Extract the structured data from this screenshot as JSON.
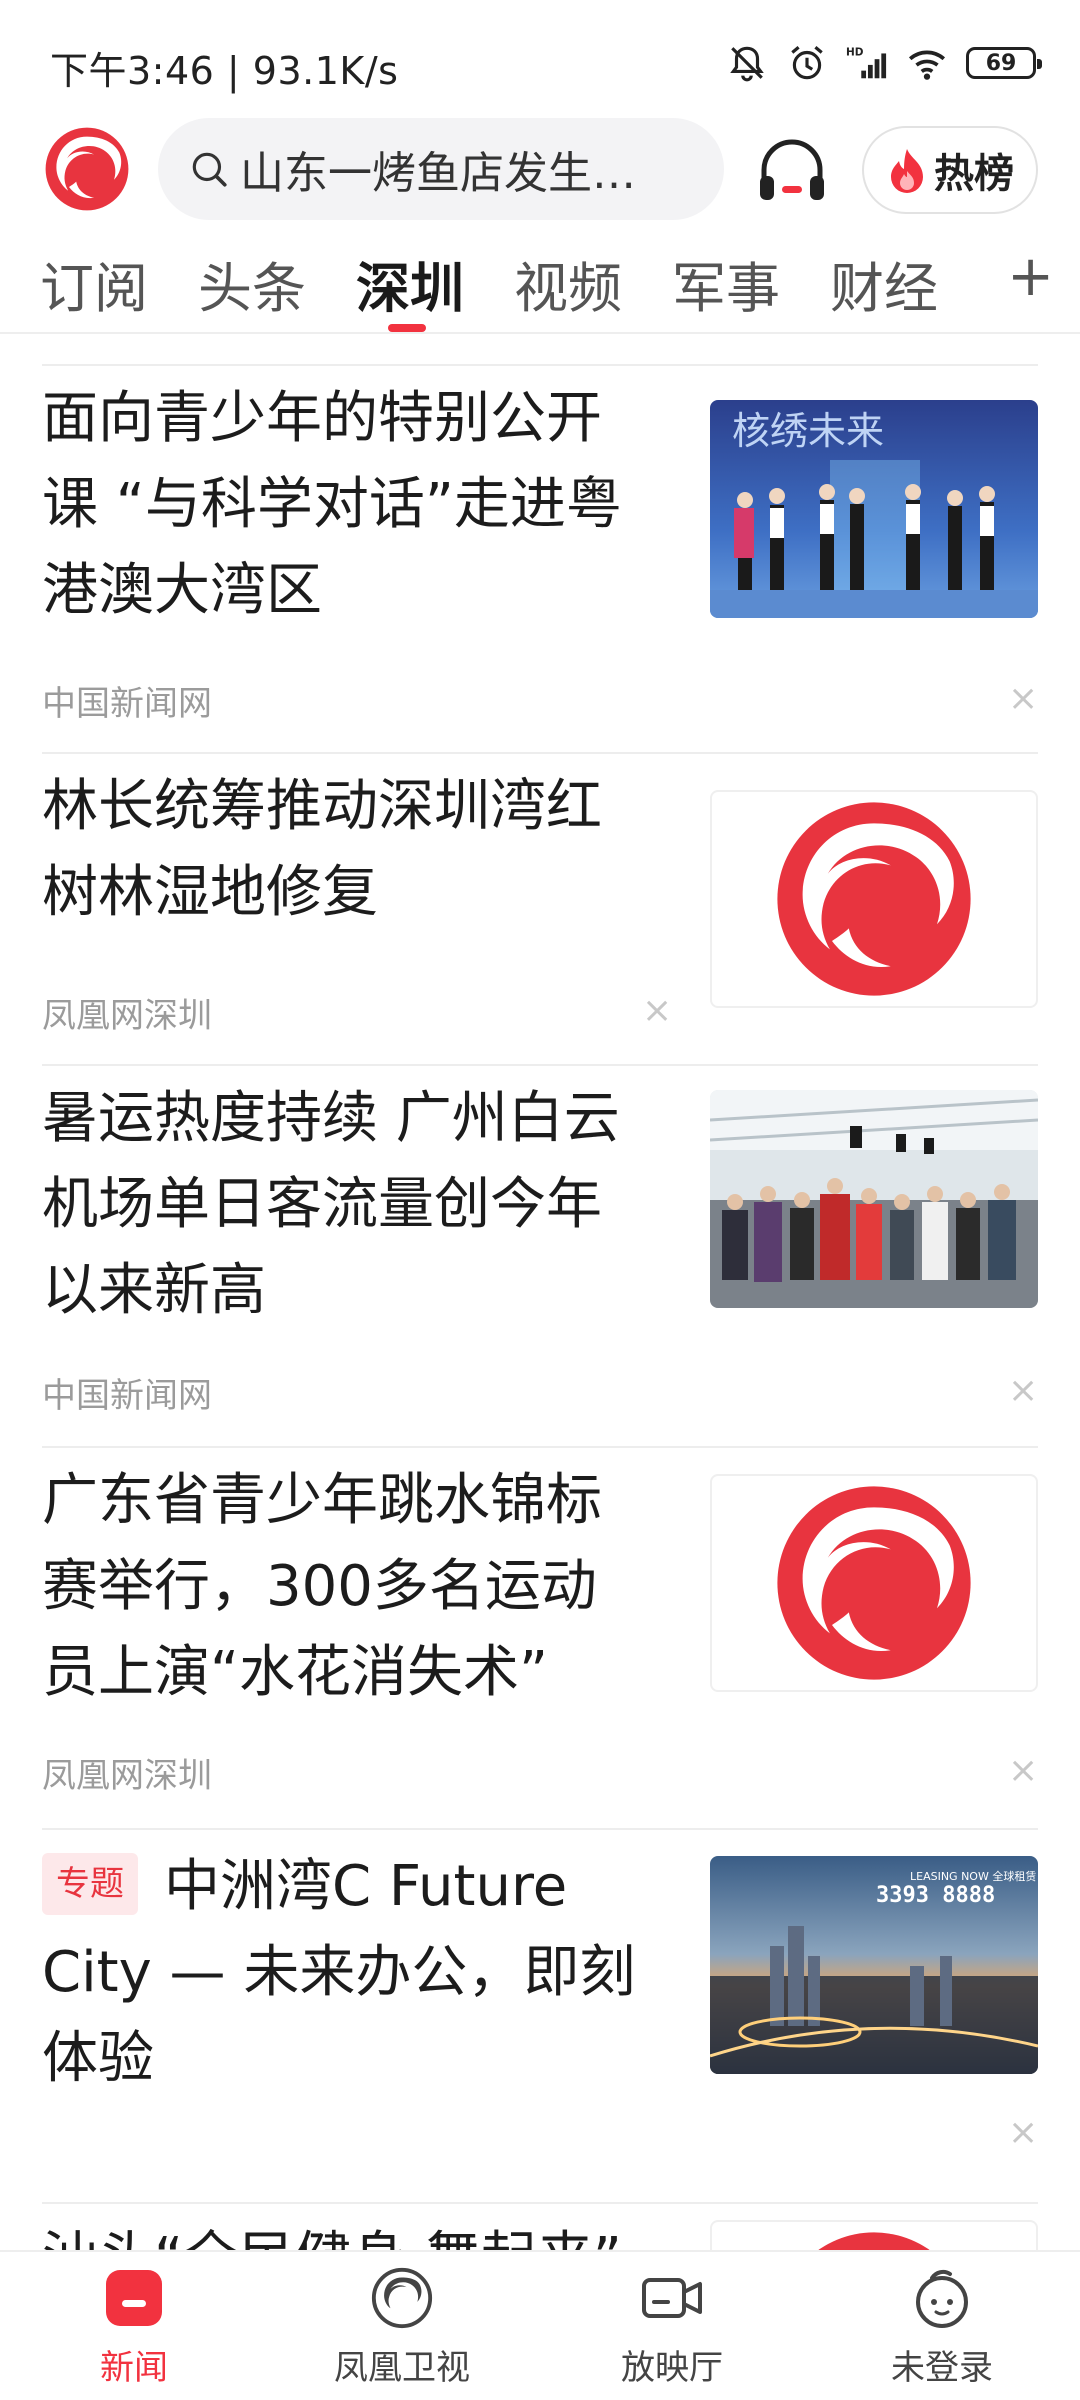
{
  "status_bar": {
    "time_speed": "下午3:46 | 93.1K/s",
    "battery": "69"
  },
  "header": {
    "search_placeholder": "山东一烤鱼店发生…",
    "hot_label": "热榜"
  },
  "tabs": [
    {
      "label": "订阅"
    },
    {
      "label": "头条"
    },
    {
      "label": "深圳"
    },
    {
      "label": "视频"
    },
    {
      "label": "军事"
    },
    {
      "label": "财经"
    }
  ],
  "tab_plus": "+",
  "feed": [
    {
      "title": "面向青少年的特别公开课 “与科学对话”走进粤港澳大湾区",
      "source": "中国新闻网",
      "thumb_text": "核绣未来"
    },
    {
      "title": "林长统筹推动深圳湾红树林湿地修复",
      "source": "凤凰网深圳"
    },
    {
      "title": "暑运热度持续 广州白云机场单日客流量创今年以来新高",
      "source": "中国新闻网"
    },
    {
      "title": "广东省青少年跳水锦标赛举行，300多名运动员上演“水花消失术”",
      "source": "凤凰网深圳"
    },
    {
      "tag": "专题",
      "title": "中洲湾C Future City — 未来办公，即刻体验",
      "thumb_text_a": "LEASING NOW 全球租赁",
      "thumb_text_b": "3393 8888"
    },
    {
      "title": "汕头“全民健身 舞起来”"
    }
  ],
  "close_glyph": "×",
  "bottom_nav": [
    {
      "label": "新闻"
    },
    {
      "label": "凤凰卫视"
    },
    {
      "label": "放映厅"
    },
    {
      "label": "未登录"
    }
  ],
  "colors": {
    "accent": "#f2323f",
    "tag_bg": "#fde8ea"
  }
}
